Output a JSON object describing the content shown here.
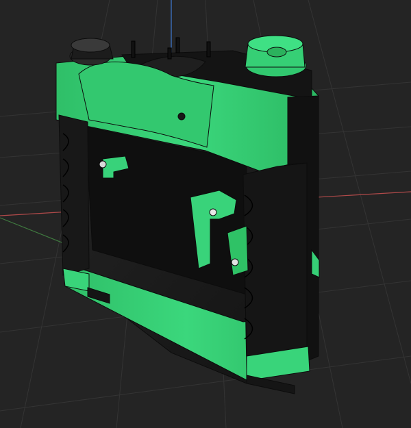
{
  "viewport": {
    "background": "#242424",
    "grid_color": "#3a3a3a",
    "x_axis_color": "#b14a4a",
    "y_axis_color": "#3f7a3f",
    "z_axis_color": "#3f7bd6"
  },
  "model": {
    "primary_color": "#39d47a",
    "secondary_color": "#1b1b1b",
    "edge_color": "#0c0c0c"
  }
}
